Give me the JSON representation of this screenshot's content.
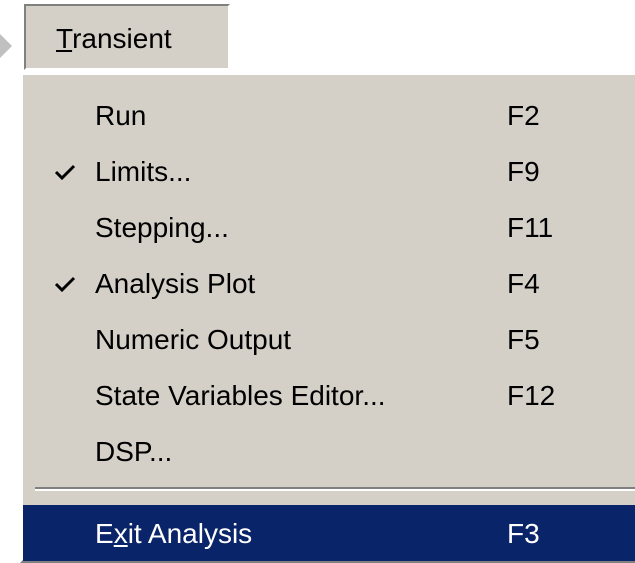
{
  "menubar": {
    "title_prefix": "T",
    "title_rest": "ransient"
  },
  "menu": {
    "items": [
      {
        "label": "Run",
        "shortcut": "F2",
        "checked": false
      },
      {
        "label": "Limits...",
        "shortcut": "F9",
        "checked": true
      },
      {
        "label": "Stepping...",
        "shortcut": "F11",
        "checked": false
      },
      {
        "label": "Analysis Plot",
        "shortcut": "F4",
        "checked": true
      },
      {
        "label": "Numeric Output",
        "shortcut": "F5",
        "checked": false
      },
      {
        "label": "State Variables Editor...",
        "shortcut": "F12",
        "checked": false
      },
      {
        "label": "DSP...",
        "shortcut": "",
        "checked": false
      }
    ],
    "exit": {
      "label_pre": "E",
      "label_u": "x",
      "label_post": "it Analysis",
      "shortcut": "F3",
      "highlighted": true
    }
  },
  "colors": {
    "menu_bg": "#d4d0c8",
    "highlight_bg": "#0a246a",
    "highlight_text": "#ffffff"
  },
  "icons": {
    "check": "checkmark-icon",
    "hint": "arrow-right-icon"
  }
}
